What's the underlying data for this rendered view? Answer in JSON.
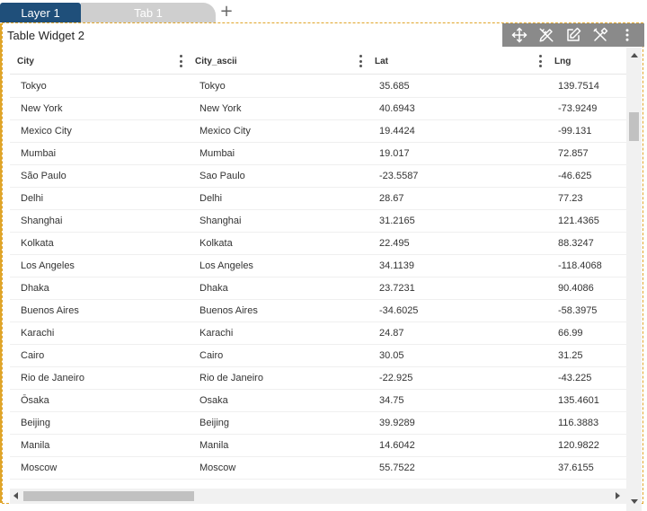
{
  "tabs": {
    "layer_label": "Layer 1",
    "tab_label": "Tab 1",
    "add_symbol": "+"
  },
  "widget": {
    "title": "Table Widget 2"
  },
  "toolbar": {
    "icons": [
      "move-icon",
      "pencil-ruler-icon",
      "edit-icon",
      "tools-icon",
      "more-vertical-icon"
    ]
  },
  "table": {
    "columns": [
      "City",
      "City_ascii",
      "Lat",
      "Lng"
    ],
    "rows": [
      [
        "Tokyo",
        "Tokyo",
        "35.685",
        "139.7514"
      ],
      [
        "New York",
        "New York",
        "40.6943",
        "-73.9249"
      ],
      [
        "Mexico City",
        "Mexico City",
        "19.4424",
        "-99.131"
      ],
      [
        "Mumbai",
        "Mumbai",
        "19.017",
        "72.857"
      ],
      [
        "São Paulo",
        "Sao Paulo",
        "-23.5587",
        "-46.625"
      ],
      [
        "Delhi",
        "Delhi",
        "28.67",
        "77.23"
      ],
      [
        "Shanghai",
        "Shanghai",
        "31.2165",
        "121.4365"
      ],
      [
        "Kolkata",
        "Kolkata",
        "22.495",
        "88.3247"
      ],
      [
        "Los Angeles",
        "Los Angeles",
        "34.1139",
        "-118.4068"
      ],
      [
        "Dhaka",
        "Dhaka",
        "23.7231",
        "90.4086"
      ],
      [
        "Buenos Aires",
        "Buenos Aires",
        "-34.6025",
        "-58.3975"
      ],
      [
        "Karachi",
        "Karachi",
        "24.87",
        "66.99"
      ],
      [
        "Cairo",
        "Cairo",
        "30.05",
        "31.25"
      ],
      [
        "Rio de Janeiro",
        "Rio de Janeiro",
        "-22.925",
        "-43.225"
      ],
      [
        "Ōsaka",
        "Osaka",
        "34.75",
        "135.4601"
      ],
      [
        "Beijing",
        "Beijing",
        "39.9289",
        "116.3883"
      ],
      [
        "Manila",
        "Manila",
        "14.6042",
        "120.9822"
      ],
      [
        "Moscow",
        "Moscow",
        "55.7522",
        "37.6155"
      ]
    ]
  },
  "colors": {
    "layer_tab": "#1f4f7a",
    "inactive_tab": "#cfcfcf",
    "selection_border": "#e0a52a",
    "toolbar_bg": "#8a8a8a"
  }
}
